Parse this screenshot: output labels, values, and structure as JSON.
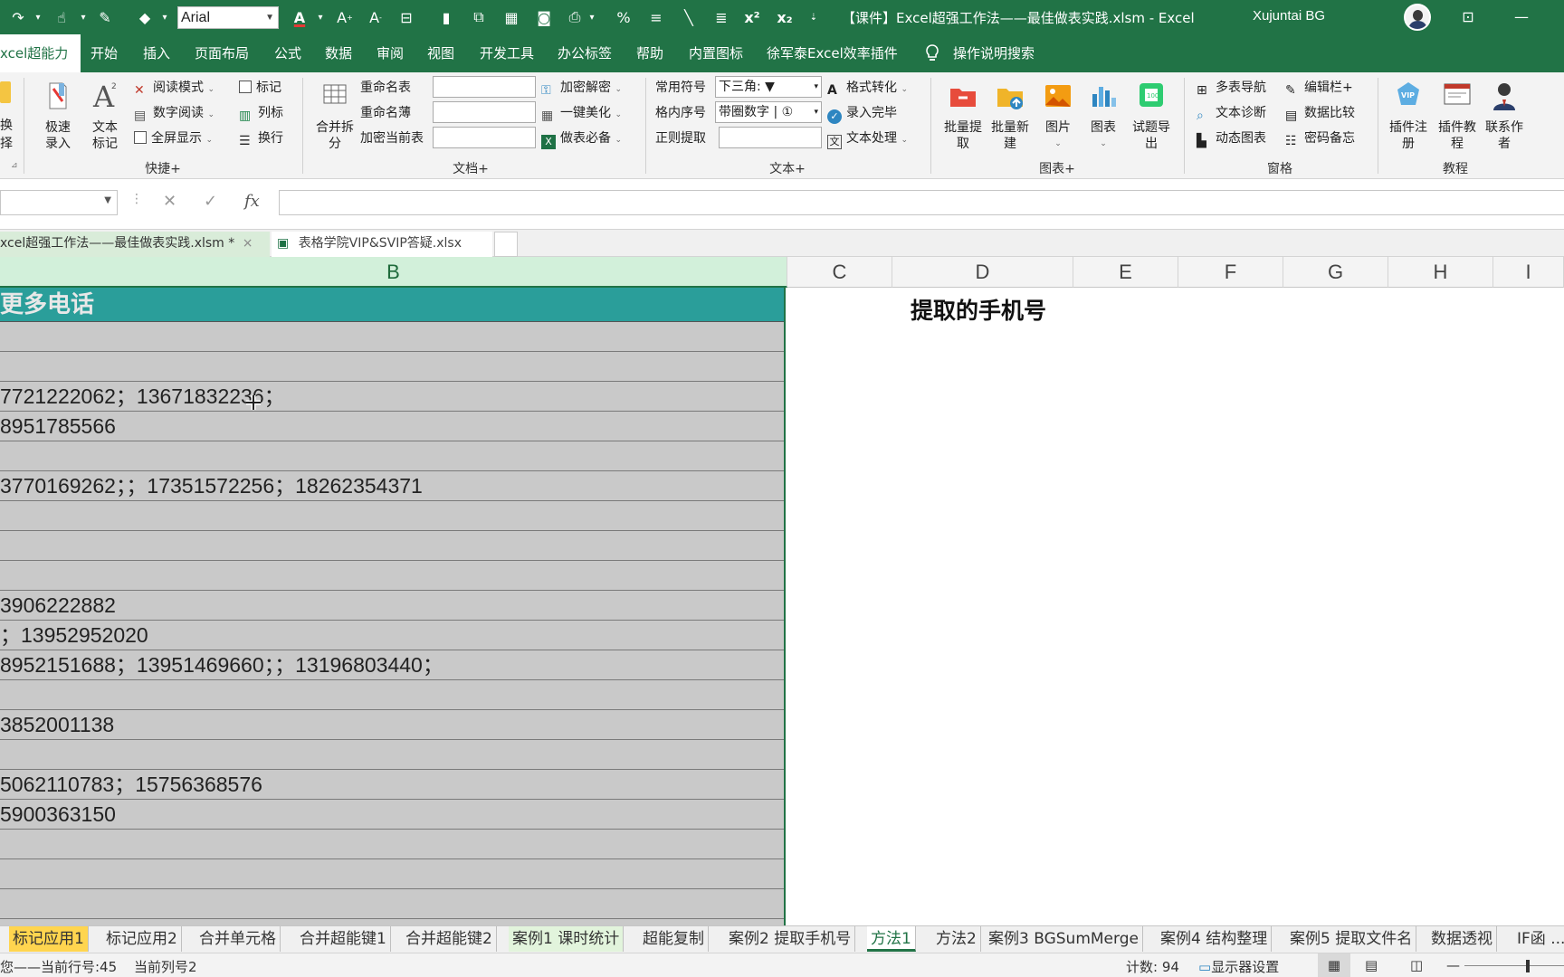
{
  "titlebar": {
    "font_name": "Arial",
    "doc_title": "【课件】Excel超强工作法——最佳做表实践.xlsm  -  Excel",
    "user_name": "Xujuntai BG",
    "qa_superscript": "x²",
    "qa_subscript": "x₂"
  },
  "tabs": [
    "xcel超能力",
    "开始",
    "插入",
    "页面布局",
    "公式",
    "数据",
    "审阅",
    "视图",
    "开发工具",
    "办公标签",
    "帮助",
    "内置图标",
    "徐军泰Excel效率插件",
    "操作说明搜索"
  ],
  "ribbon": {
    "left_cut": [
      "换",
      "择"
    ],
    "quick": {
      "big1": "极速\n录入",
      "big2": "文本\n标记",
      "read_mode": "阅读模式",
      "digit_read": "数字阅读",
      "fullscreen": "全屏显示",
      "mark": "标记",
      "col_mark": "列标",
      "wrap": "换行",
      "group": "快捷+"
    },
    "doc": {
      "merge_split": "合并拆\n分",
      "rename_sheet": "重命名表",
      "rename_book": "重命名薄",
      "encrypt_sheet": "加密当前表",
      "encrypt_decrypt": "加密解密",
      "beautify": "一键美化",
      "must_have": "做表必备",
      "group": "文档+"
    },
    "text": {
      "common_symbol": "常用符号",
      "common_symbol_val": "下三角: ▼",
      "cell_seq": "格内序号",
      "cell_seq_val": "带圈数字 | ①",
      "regex": "正则提取",
      "format_convert": "格式转化",
      "entry_done": "录入完毕",
      "text_process": "文本处理",
      "group": "文本+"
    },
    "chart": {
      "batch_extract": "批量提\n取",
      "batch_new": "批量新\n建",
      "picture": "图片",
      "chart": "图表",
      "exam_export": "试题导\n出",
      "group": "图表+"
    },
    "window": {
      "multi_nav": "多表导航",
      "text_diag": "文本诊断",
      "dynamic_chart": "动态图表",
      "edit_bar": "编辑栏+",
      "data_compare": "数据比较",
      "pwd_memo": "密码备忘",
      "group": "窗格"
    },
    "tutorial": {
      "plugin_reg": "插件注\n册",
      "plugin_tut": "插件教\n程",
      "contact": "联系作\n者",
      "group": "教程"
    }
  },
  "workbook_tabs": [
    {
      "label": "xcel超强工作法——最佳做表实践.xlsm *",
      "close": "×"
    },
    {
      "label": "表格学院VIP&SVIP答疑.xlsx"
    }
  ],
  "columns": [
    "B",
    "C",
    "D",
    "E",
    "F",
    "G",
    "H",
    "I"
  ],
  "sheet": {
    "header_text": "更多电话",
    "rows": [
      "",
      "",
      "7721222062；13671832236；",
      "8951785566",
      "",
      "3770169262；；17351572256；18262354371",
      "",
      "",
      "",
      "3906222882",
      "；13952952020",
      "8952151688；13951469660；；13196803440；",
      "",
      "3852001138",
      "",
      "5062110783；15756368576",
      "5900363150",
      "",
      "",
      ""
    ],
    "d_header": "提取的手机号"
  },
  "sheet_tabs": [
    {
      "label": "标记应用1",
      "style": "yellow"
    },
    {
      "label": "标记应用2",
      "style": ""
    },
    {
      "label": "合并单元格",
      "style": ""
    },
    {
      "label": "合并超能键1",
      "style": ""
    },
    {
      "label": "合并超能键2",
      "style": ""
    },
    {
      "label": "案例1 课时统计",
      "style": "green"
    },
    {
      "label": "超能复制",
      "style": ""
    },
    {
      "label": "案例2 提取手机号",
      "style": ""
    },
    {
      "label": "方法1",
      "style": "active"
    },
    {
      "label": "方法2",
      "style": ""
    },
    {
      "label": "案例3 BGSumMerge",
      "style": ""
    },
    {
      "label": "案例4 结构整理",
      "style": ""
    },
    {
      "label": "案例5 提取文件名",
      "style": ""
    },
    {
      "label": "数据透视",
      "style": ""
    },
    {
      "label": "IF函 ...",
      "style": ""
    }
  ],
  "status": {
    "left": "您——当前行号:45",
    "col": "当前列号2",
    "count": "计数: 94",
    "display": "显示器设置"
  },
  "colors": {
    "excel_green": "#217346",
    "header_teal": "#2a9e9a",
    "selected_gray": "#c9c9c9"
  }
}
